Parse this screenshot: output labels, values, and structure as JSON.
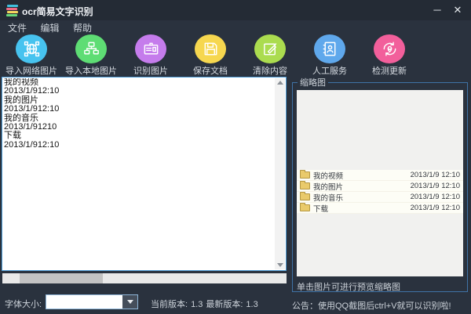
{
  "window": {
    "title": "ocr简易文字识别",
    "minimize_glyph": "─",
    "close_glyph": "✕"
  },
  "menu": {
    "items": [
      {
        "label": "文件"
      },
      {
        "label": "编辑"
      },
      {
        "label": "帮助"
      }
    ]
  },
  "toolbar": {
    "items": [
      {
        "label": "导入网络图片",
        "icon": "globe-network-icon",
        "color": "#47c3ef"
      },
      {
        "label": "导入本地图片",
        "icon": "computer-network-icon",
        "color": "#5edd74"
      },
      {
        "label": "识别图片",
        "icon": "id-card-icon",
        "color": "#c57cec"
      },
      {
        "label": "保存文档",
        "icon": "floppy-disk-icon",
        "color": "#f6d74f"
      },
      {
        "label": "清除内容",
        "icon": "edit-pencil-icon",
        "color": "#abdc4f"
      },
      {
        "label": "人工服务",
        "icon": "contact-book-icon",
        "color": "#5fa8ec"
      },
      {
        "label": "检测更新",
        "icon": "refresh-update-icon",
        "color": "#f25f9b"
      }
    ]
  },
  "editor": {
    "text": "我的视频\n2013/1/912:10\n我的图片\n2013/1/912:10\n我的音乐\n2013/1/91210\n下载\n2013/1/912:10"
  },
  "thumbnail_panel": {
    "group_title": "缩略图",
    "hint": "单击图片可进行预览缩略图",
    "files": [
      {
        "name": "我的视频",
        "date": "2013/1/9 12:10"
      },
      {
        "name": "我的图片",
        "date": "2013/1/9 12:10"
      },
      {
        "name": "我的音乐",
        "date": "2013/1/9 12:10"
      },
      {
        "name": "下载",
        "date": "2013/1/9 12:10"
      }
    ]
  },
  "statusbar": {
    "font_size_label": "字体大小:",
    "font_size_value": "",
    "current_version_label": "当前版本:",
    "current_version": "1.3",
    "latest_version_label": "最新版本:",
    "latest_version": "1.3",
    "announcement": "公告：使用QQ截图后ctrl+V就可以识别啦!"
  },
  "colors": {
    "window_bg": "#2a323e",
    "titlebar_bg": "#242b35",
    "groupbox_border": "#3f73a6",
    "textarea_border": "#4f9ed8"
  }
}
